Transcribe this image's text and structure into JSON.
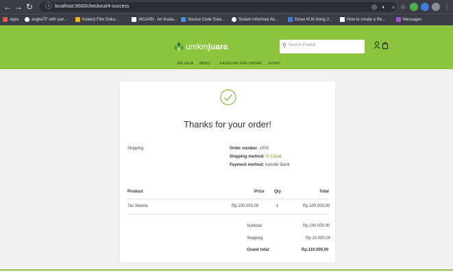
{
  "browser": {
    "url": "localhost:9000/checkout/4-success",
    "bookmarks": [
      "Apps",
      "angkaTF with yan...",
      "Koleksi Film Doku...",
      "AKUARI · Ari Kuala...",
      "Source Code Sola...",
      "Sistem Informasi Ak...",
      "Dinas KUK lining 2...",
      "How to create a Re...",
      "Messages"
    ]
  },
  "site": {
    "logo": {
      "plain": "umkm",
      "bold": "juara"
    },
    "search_placeholder": "Search Produk",
    "nav": [
      "BELANJA",
      "MENU",
      "KATEGORI",
      "PRE-ORDER",
      "EVENT"
    ]
  },
  "order": {
    "heading": "Thanks for your order!",
    "shipping_label": "Shipping",
    "order_number_label": "Order number:",
    "order_number": "1000",
    "shipping_method_label": "Shipping method:",
    "shipping_method": "Si Cepat",
    "payment_method_label": "Payment method:",
    "payment_method": "transfer Bank",
    "columns": {
      "product": "Product",
      "price": "Price",
      "qty": "Qty",
      "total": "Total"
    },
    "items": [
      {
        "product": "Tas Wanita",
        "price": "Rp.100.000,00",
        "qty": "1",
        "total": "Rp.100.000,00"
      }
    ],
    "summary": {
      "subtotal_label": "Subtotal",
      "subtotal": "Rp.100.000,00",
      "shipping_label": "Shipping",
      "shipping": "Rp.10.000,00",
      "grand_label": "Grand total:",
      "grand": "Rp.110.000,00"
    }
  },
  "colors": {
    "brand_green": "#8cc43f",
    "check_green": "#7fbf3f"
  }
}
